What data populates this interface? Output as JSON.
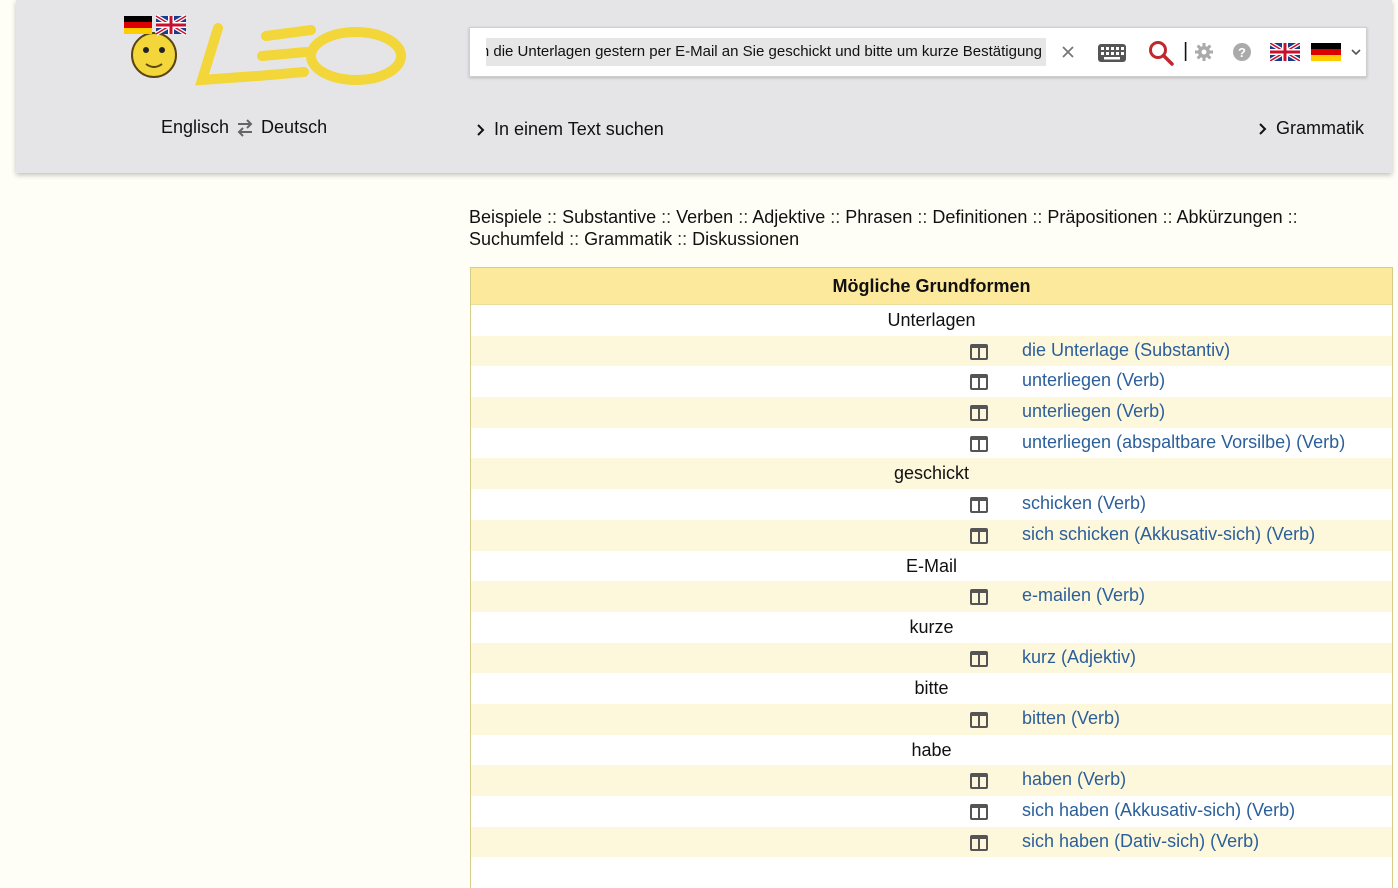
{
  "header": {
    "logo_text": "LEO",
    "lang_from": "Englisch",
    "lang_to": "Deutsch",
    "search_value": "Ich habe Ihnen die Unterlagen gestern per E-Mail an Sie geschickt und bitte um kurze Bestätigung",
    "text_search_label": "In einem Text suchen",
    "grammar_label": "Grammatik"
  },
  "colors": {
    "header_bg": "#e5e5e8",
    "page_bg": "#fffef6",
    "table_head": "#fde99c",
    "row_alt": "#fdf7dc",
    "link": "#2b5f9a",
    "search_icon": "#c0282d",
    "logo_yellow": "#f2d63a"
  },
  "section_nav": [
    "Beispiele",
    "Substantive",
    "Verben",
    "Adjektive",
    "Phrasen",
    "Definitionen",
    "Präpositionen",
    "Abkürzungen",
    "Suchumfeld",
    "Grammatik",
    "Diskussionen"
  ],
  "results": {
    "title": "Mögliche Grundformen",
    "rows": [
      {
        "type": "word",
        "text": "Unterlagen"
      },
      {
        "type": "link",
        "text": "die Unterlage (Substantiv)"
      },
      {
        "type": "link",
        "text": "unterliegen (Verb)"
      },
      {
        "type": "link",
        "text": "unterliegen (Verb)"
      },
      {
        "type": "link",
        "text": "unterliegen (abspaltbare Vorsilbe) (Verb)"
      },
      {
        "type": "word",
        "text": "geschickt"
      },
      {
        "type": "link",
        "text": "schicken (Verb)"
      },
      {
        "type": "link",
        "text": "sich schicken (Akkusativ-sich) (Verb)"
      },
      {
        "type": "word",
        "text": "E-Mail"
      },
      {
        "type": "link",
        "text": "e-mailen (Verb)"
      },
      {
        "type": "word",
        "text": "kurze"
      },
      {
        "type": "link",
        "text": "kurz (Adjektiv)"
      },
      {
        "type": "word",
        "text": "bitte"
      },
      {
        "type": "link",
        "text": "bitten (Verb)"
      },
      {
        "type": "word",
        "text": "habe"
      },
      {
        "type": "link",
        "text": "haben (Verb)"
      },
      {
        "type": "link",
        "text": "sich haben (Akkusativ-sich) (Verb)"
      },
      {
        "type": "link",
        "text": "sich haben (Dativ-sich) (Verb)"
      }
    ]
  }
}
